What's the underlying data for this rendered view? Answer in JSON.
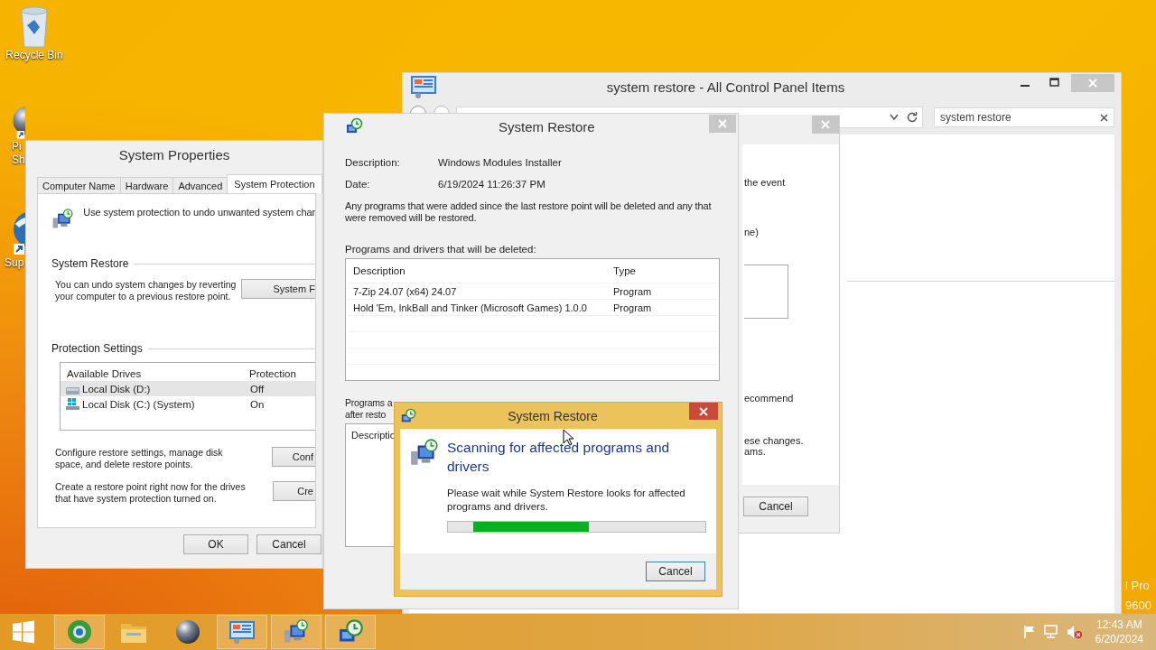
{
  "desktop_icons": [
    {
      "kind": "recycle-bin",
      "lines": [
        "Recycle Bin"
      ]
    },
    {
      "kind": "sphere",
      "lines": [
        "Pi",
        "Sh"
      ]
    },
    {
      "kind": "globe",
      "lines": [
        "Sup"
      ]
    }
  ],
  "control_panel": {
    "title": "system restore - All Control Panel Items",
    "search": {
      "value": "system restore"
    }
  },
  "background_dialog": {
    "lines": [
      "the event",
      "ne)",
      "ecommend",
      "ese changes.",
      "ams."
    ],
    "button": "Cancel"
  },
  "system_properties": {
    "title": "System Properties",
    "tabs": [
      {
        "label": "Computer Name",
        "selected": false
      },
      {
        "label": "Hardware",
        "selected": false
      },
      {
        "label": "Advanced",
        "selected": false
      },
      {
        "label": "System Protection",
        "selected": true
      }
    ],
    "intro": "Use system protection to undo unwanted system char",
    "restore_heading": "System Restore",
    "restore_text": "You can undo system changes by reverting your computer to a previous restore point.",
    "restore_button": "System F",
    "protection_heading": "Protection Settings",
    "columns": [
      "Available Drives",
      "Protection"
    ],
    "drives": [
      {
        "kind": "data",
        "name": "Local Disk (D:)",
        "protection": "Off",
        "selected": true
      },
      {
        "kind": "system",
        "name": "Local Disk (C:) (System)",
        "protection": "On",
        "selected": false
      }
    ],
    "configure_text": "Configure restore settings, manage disk space, and delete restore points.",
    "configure_button": "Conf",
    "create_text": "Create a restore point right now for the drives that have system protection turned on.",
    "create_button": "Cre",
    "buttons": [
      "OK",
      "Cancel"
    ]
  },
  "system_restore": {
    "title": "System Restore",
    "description_label": "Description:",
    "description": "Windows Modules Installer",
    "date_label": "Date:",
    "date": "6/19/2024 11:26:37 PM",
    "note": "Any programs that were added since the last restore point will be deleted and any that were removed will be restored.",
    "deleted_label": "Programs and drivers that will be deleted:",
    "columns": [
      "Description",
      "Type"
    ],
    "rows": [
      {
        "description": "7-Zip 24.07 (x64) 24.07",
        "type": "Program"
      },
      {
        "description": "Hold 'Em, InkBall and Tinker (Microsoft Games) 1.0.0",
        "type": "Program"
      }
    ],
    "restored_label": [
      "Programs a",
      "after resto"
    ],
    "restored_column": "Descriptio"
  },
  "progress_dialog": {
    "title": "System Restore",
    "heading": "Scanning for affected programs and drivers",
    "message": "Please wait while System Restore looks for affected programs and drivers.",
    "button": "Cancel"
  },
  "edition_text": [
    "l Pro",
    "9600"
  ],
  "taskbar": {
    "apps": [
      {
        "kind": "globe",
        "running": true
      },
      {
        "kind": "folder",
        "running": false
      },
      {
        "kind": "sphere",
        "running": false
      },
      {
        "kind": "control-panel",
        "running": true
      },
      {
        "kind": "monitor",
        "running": true
      },
      {
        "kind": "restore",
        "running": true
      }
    ],
    "clock": {
      "time": "12:43 AM",
      "date": "6/20/2024"
    }
  }
}
